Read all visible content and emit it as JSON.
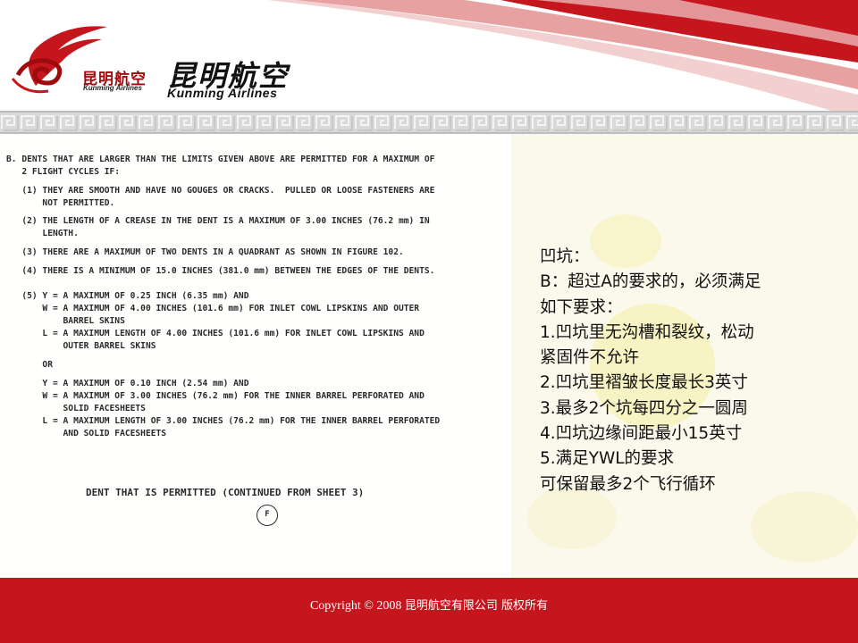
{
  "brand": {
    "small_cn": "昆明航空",
    "small_en": "Kunming Airlines",
    "big_cn": "昆明航空",
    "big_en": "Kunming Airlines",
    "colors": {
      "primary_red": "#c4161c",
      "dark_red": "#9e0b0f"
    }
  },
  "document": {
    "lines": [
      "B. DENTS THAT ARE LARGER THAN THE LIMITS GIVEN ABOVE ARE PERMITTED FOR A MAXIMUM OF",
      "   2 FLIGHT CYCLES IF:",
      "   (1) THEY ARE SMOOTH AND HAVE NO GOUGES OR CRACKS.  PULLED OR LOOSE FASTENERS ARE",
      "       NOT PERMITTED.",
      "   (2) THE LENGTH OF A CREASE IN THE DENT IS A MAXIMUM OF 3.00 INCHES (76.2 mm) IN",
      "       LENGTH.",
      "   (3) THERE ARE A MAXIMUM OF TWO DENTS IN A QUADRANT AS SHOWN IN FIGURE 102.",
      "   (4) THERE IS A MINIMUM OF 15.0 INCHES (381.0 mm) BETWEEN THE EDGES OF THE DENTS.",
      "   (5) Y = A MAXIMUM OF 0.25 INCH (6.35 mm) AND",
      "       W = A MAXIMUM OF 4.00 INCHES (101.6 mm) FOR INLET COWL LIPSKINS AND OUTER",
      "           BARREL SKINS",
      "       L = A MAXIMUM LENGTH OF 4.00 INCHES (101.6 mm) FOR INLET COWL LIPSKINS AND",
      "           OUTER BARREL SKINS",
      "       OR",
      "       Y = A MAXIMUM OF 0.10 INCH (2.54 mm) AND",
      "       W = A MAXIMUM OF 3.00 INCHES (76.2 mm) FOR THE INNER BARREL PERFORATED AND",
      "           SOLID FACESHEETS",
      "       L = A MAXIMUM LENGTH OF 3.00 INCHES (76.2 mm) FOR THE INNER BARREL PERFORATED",
      "           AND SOLID FACESHEETS"
    ],
    "caption": "DENT THAT IS PERMITTED (CONTINUED FROM SHEET 3)",
    "marker": "F"
  },
  "notes": {
    "lines": [
      "凹坑：",
      "B：超过A的要求的，必须满足",
      "如下要求：",
      "1.凹坑里无沟槽和裂纹，松动",
      "紧固件不允许",
      "2.凹坑里褶皱长度最长3英寸",
      "3.最多2个坑每四分之一圆周",
      "4.凹坑边缘间距最小15英寸",
      "5.满足YWL的要求",
      "可保留最多2个飞行循环"
    ]
  },
  "footer": {
    "copyright": "Copyright  © 2008",
    "company": "昆明航空有限公司  版权所有"
  }
}
